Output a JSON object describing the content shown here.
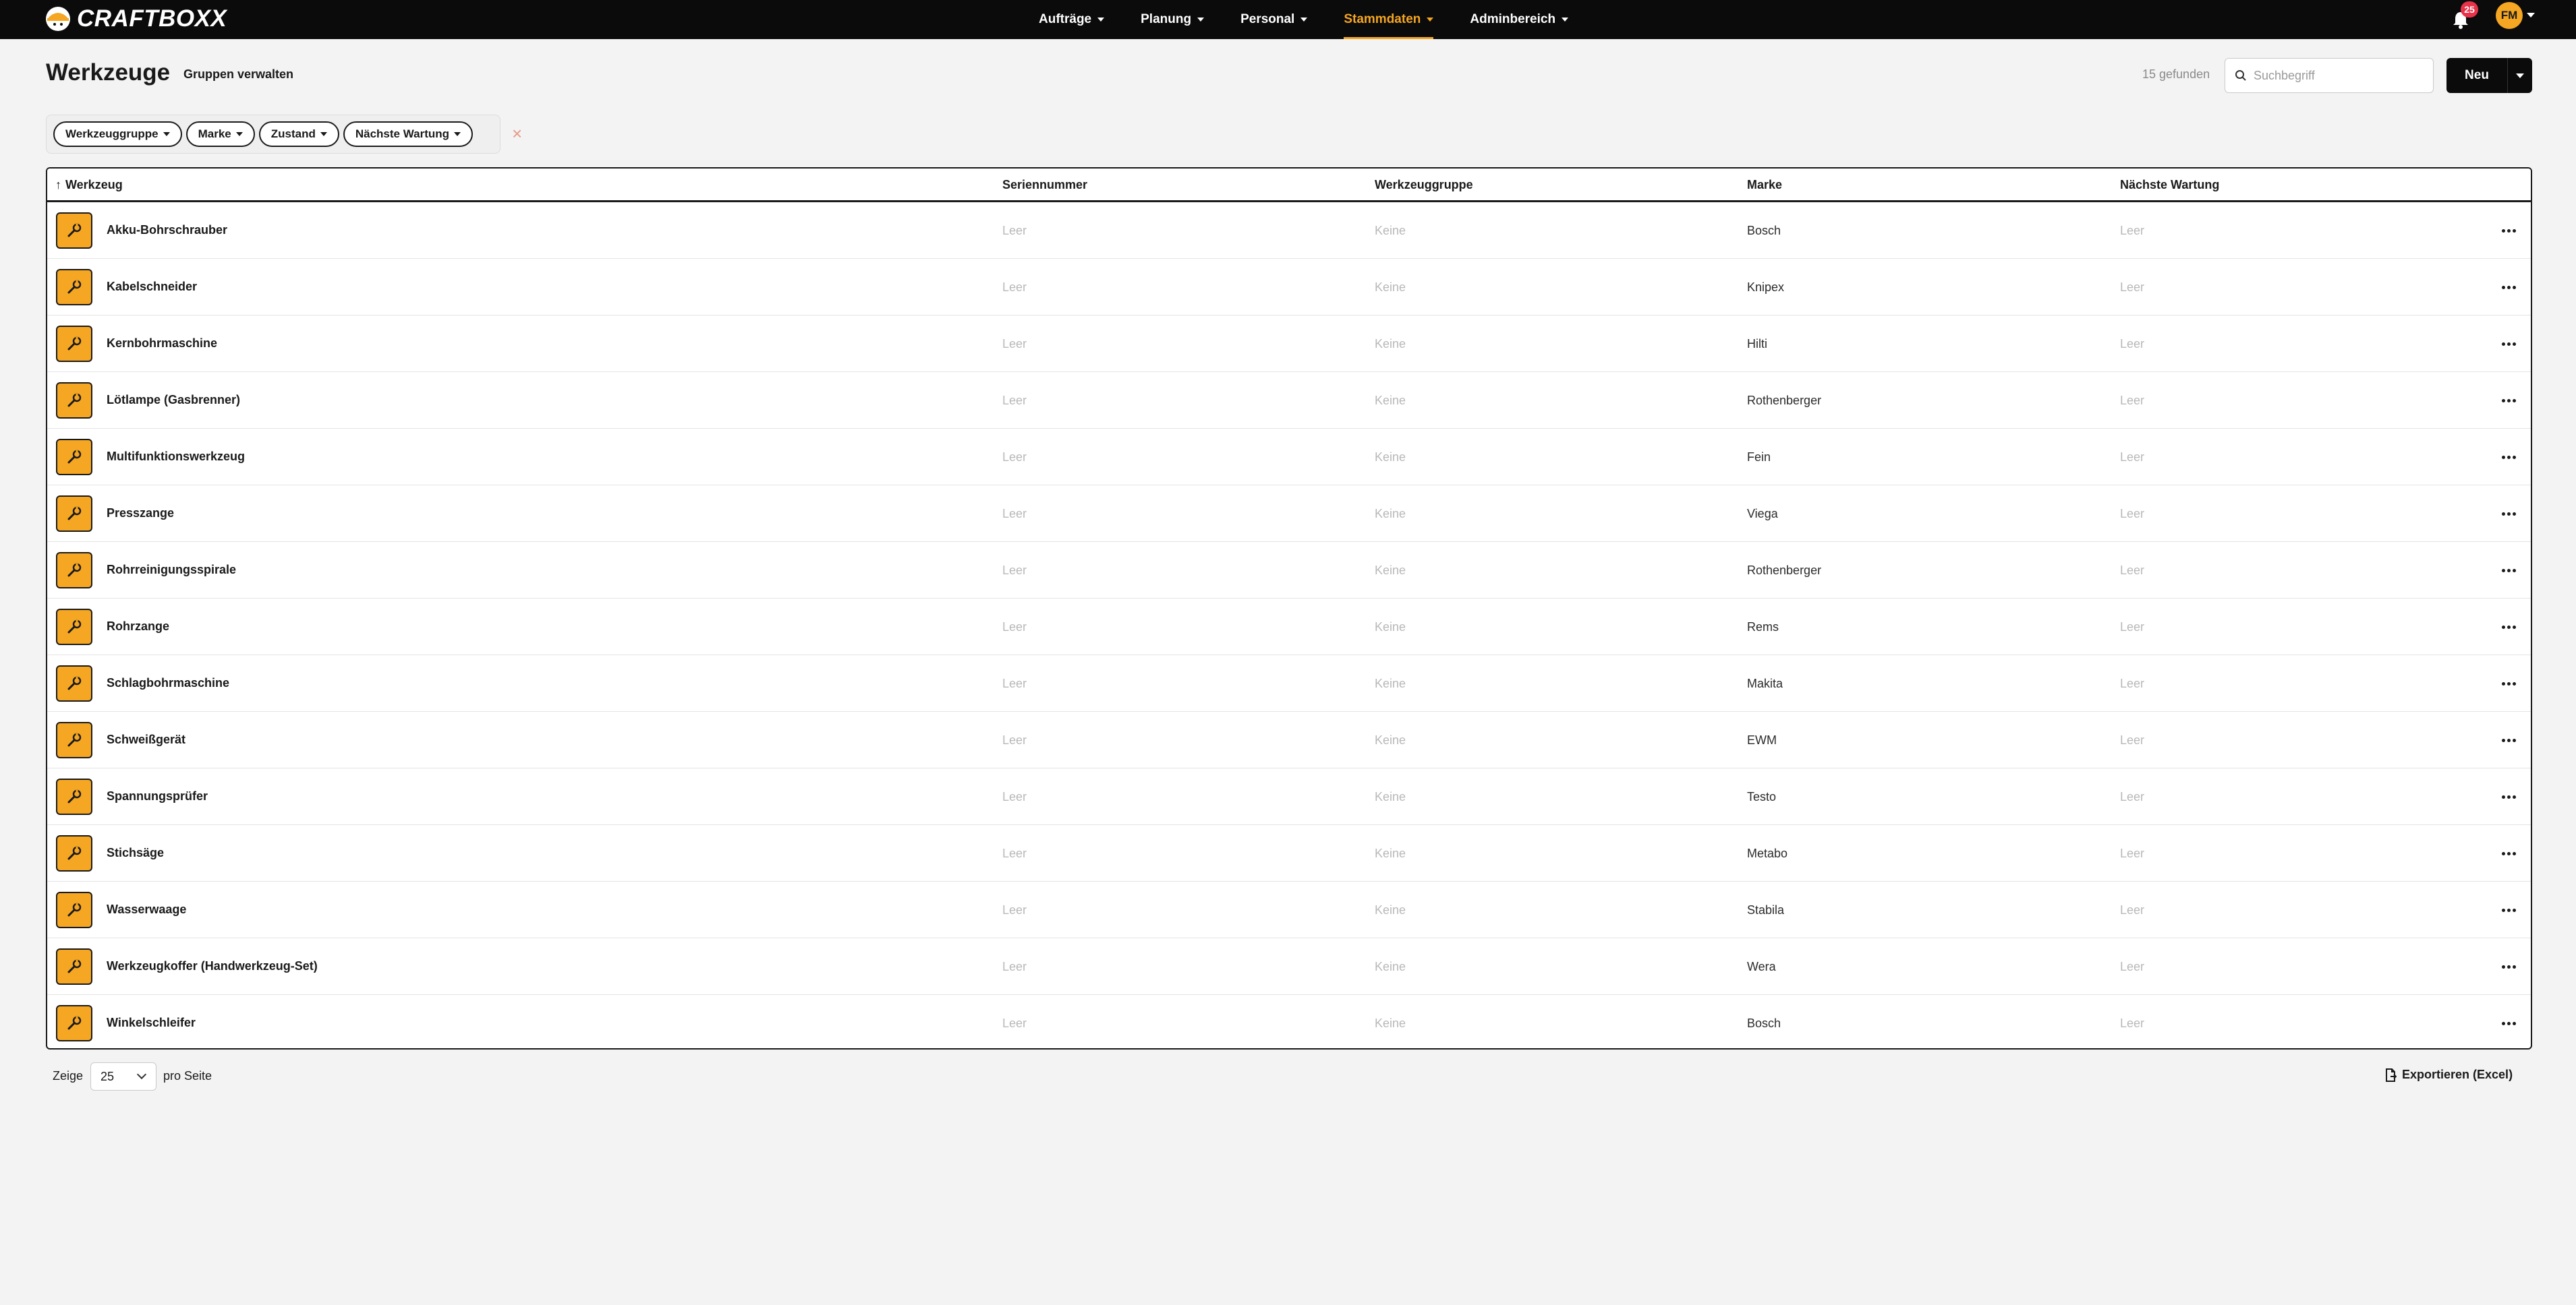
{
  "app": {
    "brand": "CRAFTBOXX",
    "accent": "#f5a623"
  },
  "nav": {
    "items": [
      {
        "label": "Aufträge"
      },
      {
        "label": "Planung"
      },
      {
        "label": "Personal"
      },
      {
        "label": "Stammdaten",
        "active": true
      },
      {
        "label": "Adminbereich"
      }
    ],
    "notifications": "25",
    "user_initials": "FM"
  },
  "header": {
    "title": "Werkzeuge",
    "groups_link": "Gruppen verwalten",
    "found": "15 gefunden",
    "search_placeholder": "Suchbegriff",
    "new_label": "Neu"
  },
  "filters": {
    "chips": [
      "Werkzeuggruppe",
      "Marke",
      "Zustand",
      "Nächste Wartung"
    ],
    "clear": "×"
  },
  "table": {
    "columns": [
      "Werkzeug",
      "Seriennummer",
      "Werkzeuggruppe",
      "Marke",
      "Nächste Wartung"
    ],
    "rows": [
      {
        "name": "Akku-Bohrschrauber",
        "serial": "Leer",
        "group": "Keine",
        "brand": "Bosch",
        "maintenance": "Leer"
      },
      {
        "name": "Kabelschneider",
        "serial": "Leer",
        "group": "Keine",
        "brand": "Knipex",
        "maintenance": "Leer"
      },
      {
        "name": "Kernbohrmaschine",
        "serial": "Leer",
        "group": "Keine",
        "brand": "Hilti",
        "maintenance": "Leer"
      },
      {
        "name": "Lötlampe (Gasbrenner)",
        "serial": "Leer",
        "group": "Keine",
        "brand": "Rothenberger",
        "maintenance": "Leer"
      },
      {
        "name": "Multifunktionswerkzeug",
        "serial": "Leer",
        "group": "Keine",
        "brand": "Fein",
        "maintenance": "Leer"
      },
      {
        "name": "Presszange",
        "serial": "Leer",
        "group": "Keine",
        "brand": "Viega",
        "maintenance": "Leer"
      },
      {
        "name": "Rohrreinigungsspirale",
        "serial": "Leer",
        "group": "Keine",
        "brand": "Rothenberger",
        "maintenance": "Leer"
      },
      {
        "name": "Rohrzange",
        "serial": "Leer",
        "group": "Keine",
        "brand": "Rems",
        "maintenance": "Leer"
      },
      {
        "name": "Schlagbohrmaschine",
        "serial": "Leer",
        "group": "Keine",
        "brand": "Makita",
        "maintenance": "Leer"
      },
      {
        "name": "Schweißgerät",
        "serial": "Leer",
        "group": "Keine",
        "brand": "EWM",
        "maintenance": "Leer"
      },
      {
        "name": "Spannungsprüfer",
        "serial": "Leer",
        "group": "Keine",
        "brand": "Testo",
        "maintenance": "Leer"
      },
      {
        "name": "Stichsäge",
        "serial": "Leer",
        "group": "Keine",
        "brand": "Metabo",
        "maintenance": "Leer"
      },
      {
        "name": "Wasserwaage",
        "serial": "Leer",
        "group": "Keine",
        "brand": "Stabila",
        "maintenance": "Leer"
      },
      {
        "name": "Werkzeugkoffer (Handwerkzeug-Set)",
        "serial": "Leer",
        "group": "Keine",
        "brand": "Wera",
        "maintenance": "Leer"
      },
      {
        "name": "Winkelschleifer",
        "serial": "Leer",
        "group": "Keine",
        "brand": "Bosch",
        "maintenance": "Leer"
      }
    ]
  },
  "footer": {
    "show_label": "Zeige",
    "per_page_value": "25",
    "per_page_label": "pro Seite",
    "export_label": "Exportieren (Excel)"
  }
}
